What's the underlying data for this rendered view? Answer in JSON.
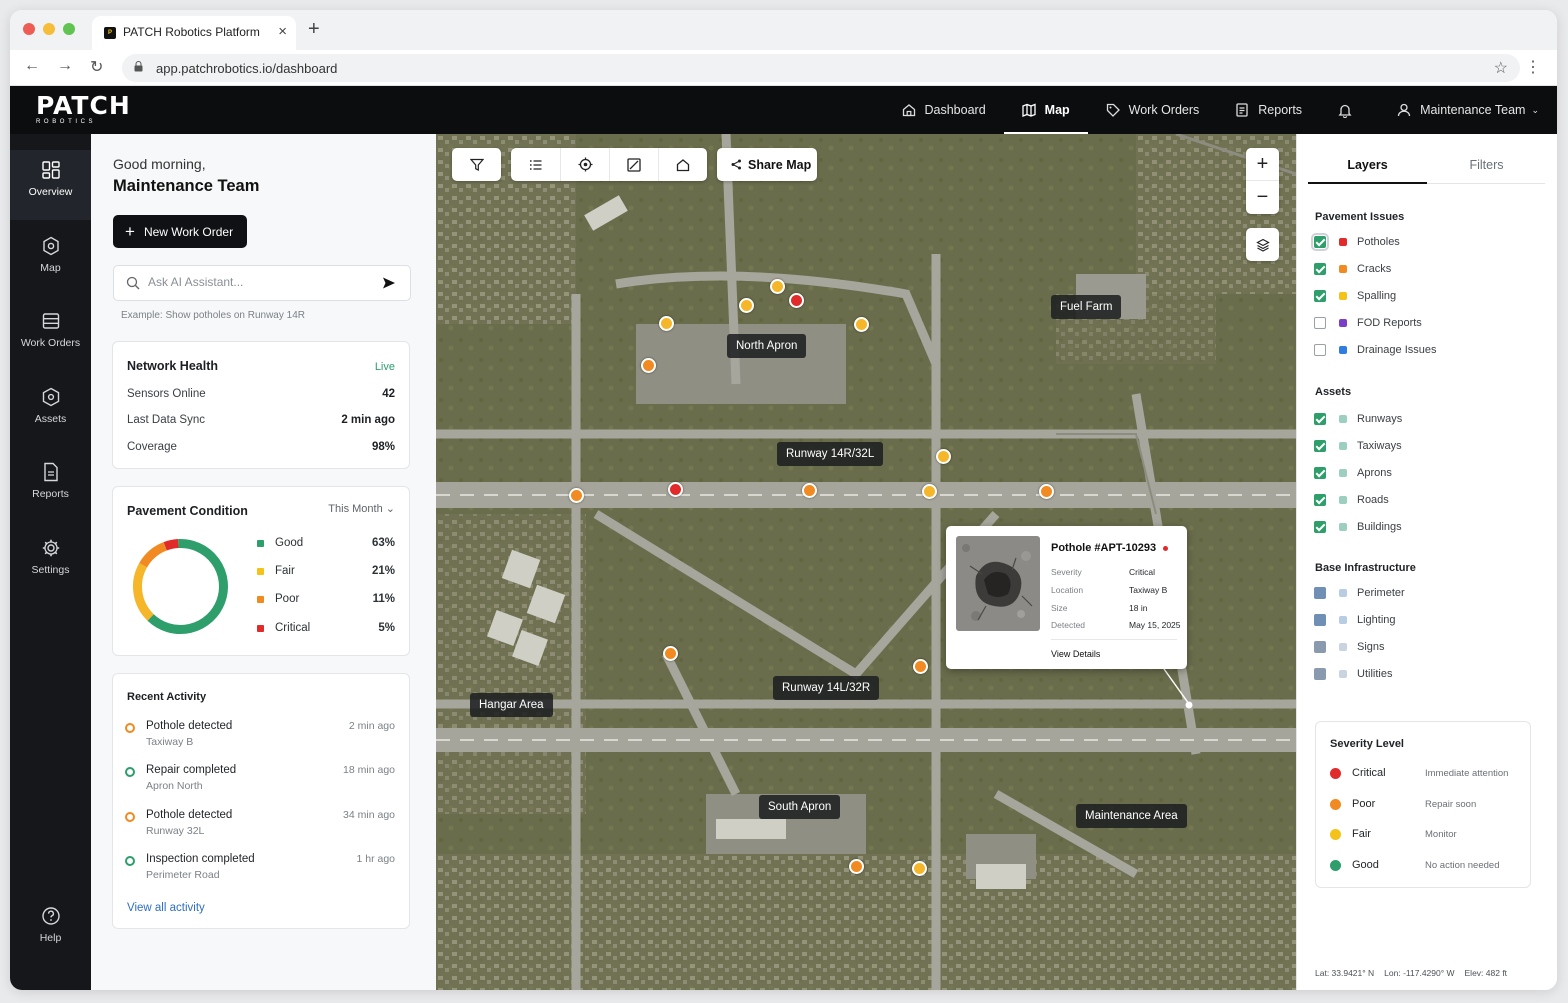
{
  "browser": {
    "tab_title": "PATCH Robotics Platform",
    "url": "app.patchrobotics.io/dashboard"
  },
  "header": {
    "logo_main": "PATCH",
    "logo_sub": "ROBOTICS",
    "nav": [
      {
        "label": "Dashboard",
        "icon": "home-icon"
      },
      {
        "label": "Map",
        "icon": "map-icon",
        "active": true
      },
      {
        "label": "Work Orders",
        "icon": "tag-icon"
      },
      {
        "label": "Reports",
        "icon": "report-icon"
      }
    ],
    "user": "Maintenance Team"
  },
  "rail": {
    "items": [
      {
        "label": "Overview",
        "icon": "grid-icon",
        "active": true
      },
      {
        "label": "Map",
        "icon": "map-pin-icon"
      },
      {
        "label": "Work Orders",
        "icon": "list-icon"
      },
      {
        "label": "Assets",
        "icon": "hexagon-icon"
      },
      {
        "label": "Reports",
        "icon": "document-icon"
      },
      {
        "label": "Settings",
        "icon": "gear-icon"
      }
    ],
    "help": "Help"
  },
  "left": {
    "greeting": "Good morning,",
    "team": "Maintenance Team",
    "new_wo": "New Work Order",
    "ai_placeholder": "Ask AI Assistant...",
    "ai_example": "Example: Show potholes on Runway 14R",
    "network": {
      "title": "Network Health",
      "status": "Live",
      "rows": [
        {
          "k": "Sensors Online",
          "v": "42"
        },
        {
          "k": "Last Data Sync",
          "v": "2 min ago"
        },
        {
          "k": "Coverage",
          "v": "98%"
        }
      ]
    },
    "pavement": {
      "title": "Pavement Condition",
      "period": "This Month",
      "items": [
        {
          "label": "Good",
          "pct": "63%",
          "value": 63,
          "color": "#2e9e6b"
        },
        {
          "label": "Fair",
          "pct": "21%",
          "value": 21,
          "color": "#f5b62a"
        },
        {
          "label": "Poor",
          "pct": "11%",
          "value": 11,
          "color": "#f18a20"
        },
        {
          "label": "Critical",
          "pct": "5%",
          "value": 5,
          "color": "#e12a2a"
        }
      ]
    },
    "activity": {
      "title": "Recent Activity",
      "items": [
        {
          "title": "Pothole detected",
          "sub": "Taxiway B",
          "time": "2 min ago",
          "color": "#f18a20"
        },
        {
          "title": "Repair completed",
          "sub": "Apron North",
          "time": "18 min ago",
          "color": "#2e9e6b"
        },
        {
          "title": "Pothole detected",
          "sub": "Runway 32L",
          "time": "34 min ago",
          "color": "#f18a20"
        },
        {
          "title": "Inspection completed",
          "sub": "Perimeter Road",
          "time": "1 hr ago",
          "color": "#2e9e6b"
        }
      ],
      "view_all": "View all activity"
    }
  },
  "map": {
    "share": "Share Map",
    "labels": {
      "north_apron": "North Apron",
      "fuel_farm": "Fuel Farm",
      "runway_14r": "Runway 14R/32L",
      "runway_14l": "Runway 14L/32R",
      "hangar": "Hangar Area",
      "south_apron": "South Apron",
      "maintenance": "Maintenance Area"
    },
    "popup": {
      "title": "Pothole #APT-10293",
      "rows": [
        {
          "k": "Severity",
          "v": "Critical"
        },
        {
          "k": "Location",
          "v": "Taxiway B"
        },
        {
          "k": "Size",
          "v": "18 in"
        },
        {
          "k": "Detected",
          "v": "May 15, 2025"
        }
      ],
      "link": "View Details"
    }
  },
  "right": {
    "tabs": [
      "Layers",
      "Filters"
    ],
    "pavement_title": "Pavement Issues",
    "pavement": [
      {
        "label": "Potholes",
        "checked": true,
        "color": "#e12a2a"
      },
      {
        "label": "Cracks",
        "checked": true,
        "color": "#f18a20"
      },
      {
        "label": "Spalling",
        "checked": true,
        "color": "#f5c21a"
      },
      {
        "label": "FOD Reports",
        "checked": false,
        "color": "#7b3fc7"
      },
      {
        "label": "Drainage Issues",
        "checked": false,
        "color": "#2f7de0"
      }
    ],
    "assets_title": "Assets",
    "assets": [
      {
        "label": "Runways",
        "color": "#9ccfc0"
      },
      {
        "label": "Taxiways",
        "color": "#9ccfc0"
      },
      {
        "label": "Aprons",
        "color": "#9ccfc0"
      },
      {
        "label": "Roads",
        "color": "#9ccfc0"
      },
      {
        "label": "Buildings",
        "color": "#9ccfc0"
      }
    ],
    "infra_title": "Base Infrastructure",
    "infra": [
      {
        "label": "Perimeter",
        "color": "#b7cde3"
      },
      {
        "label": "Lighting",
        "color": "#b7cde3"
      },
      {
        "label": "Signs",
        "color": "#b7cde3"
      },
      {
        "label": "Utilities",
        "color": "#b7cde3"
      }
    ],
    "severity_title": "Severity Level",
    "severity": [
      {
        "label": "Critical",
        "desc": "Immediate attention",
        "color": "#e12a2a"
      },
      {
        "label": "Poor",
        "desc": "Repair soon",
        "color": "#f18a20"
      },
      {
        "label": "Fair",
        "desc": "Monitor",
        "color": "#f5c21a"
      },
      {
        "label": "Good",
        "desc": "No action needed",
        "color": "#2e9e6b"
      }
    ],
    "coords": {
      "lat": "Lat: 33.9421° N",
      "lon": "Lon: -117.4290° W",
      "elev": "Elev: 482 ft"
    }
  }
}
